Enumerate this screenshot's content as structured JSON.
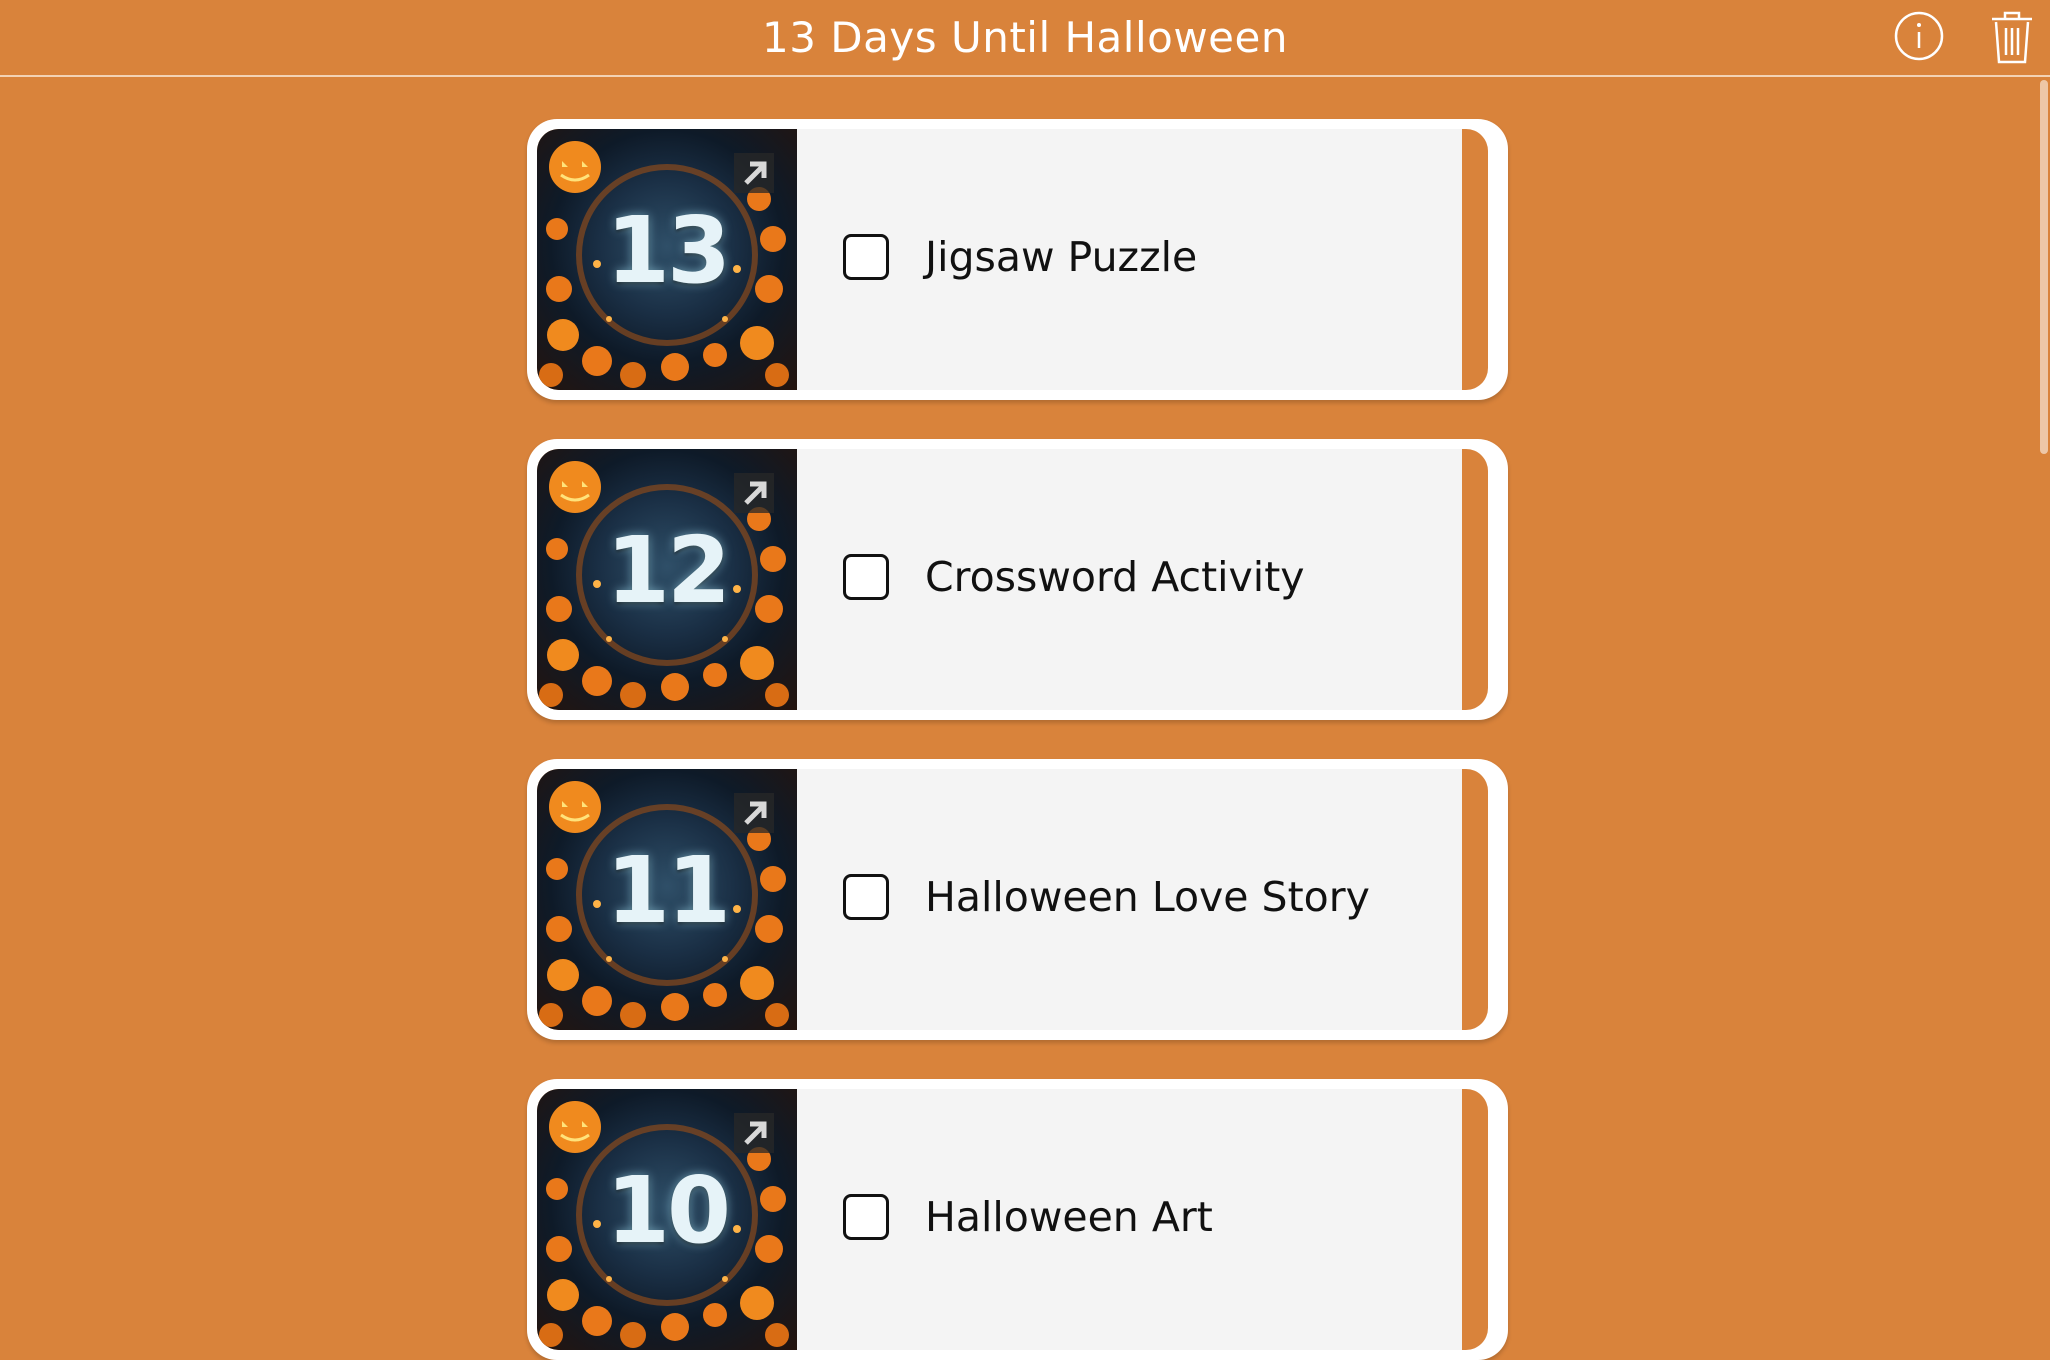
{
  "header": {
    "title": "13 Days Until Halloween",
    "info_icon": "info-icon",
    "trash_icon": "trash-icon"
  },
  "colors": {
    "background": "#d9833b",
    "card_border": "#ffffff",
    "card_content": "#f4f4f4",
    "text": "#111111",
    "header_text": "#ffffff"
  },
  "tasks": [
    {
      "day": "13",
      "label": "Jigsaw Puzzle",
      "checked": false
    },
    {
      "day": "12",
      "label": "Crossword Activity",
      "checked": false
    },
    {
      "day": "11",
      "label": "Halloween Love Story",
      "checked": false
    },
    {
      "day": "10",
      "label": "Halloween Art",
      "checked": false
    }
  ]
}
